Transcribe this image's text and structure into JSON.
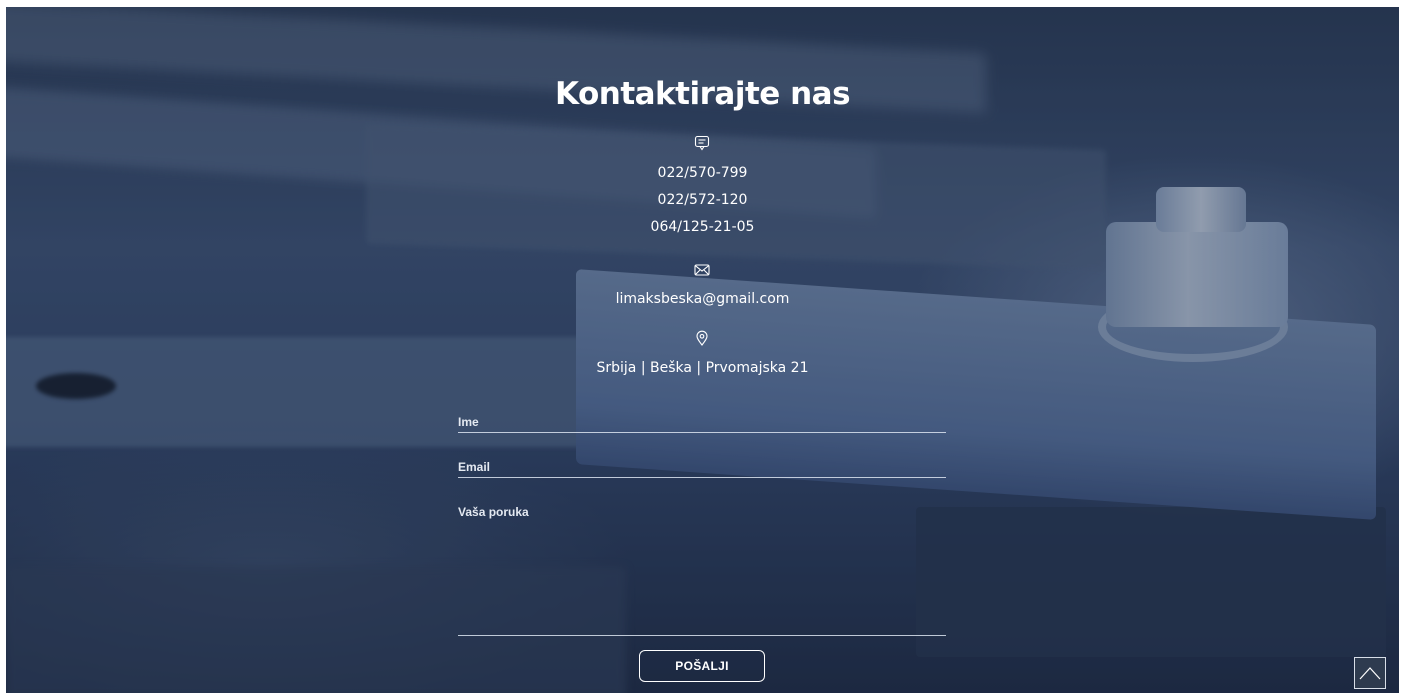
{
  "contact": {
    "title": "Kontaktirajte nas",
    "phones": [
      "022/570-799",
      "022/572-120",
      "064/125-21-05"
    ],
    "email": "limaksbeska@gmail.com",
    "address": "Srbija | Beška | Prvomajska 21"
  },
  "form": {
    "name_label": "Ime",
    "email_label": "Email",
    "message_label": "Vaša poruka",
    "submit_label": "POŠALJI"
  },
  "icons": {
    "phone": "chat-bubble-icon",
    "email": "envelope-icon",
    "address": "location-pin-icon",
    "scroll_top": "chevron-up-icon"
  }
}
